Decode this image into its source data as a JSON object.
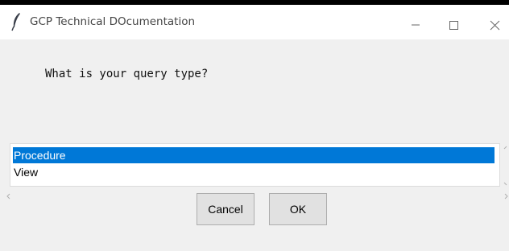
{
  "window": {
    "title": "GCP Technical DOcumentation",
    "controls": {
      "minimize_icon": "minimize-icon",
      "maximize_icon": "maximize-icon",
      "close_icon": "close-icon"
    }
  },
  "prompt": {
    "text": "What is your query type?"
  },
  "listbox": {
    "items": [
      {
        "label": "Procedure",
        "selected": true
      },
      {
        "label": "View",
        "selected": false
      }
    ]
  },
  "buttons": {
    "cancel_label": "Cancel",
    "ok_label": "OK"
  },
  "colors": {
    "selection": "#0078d7",
    "window_bg": "#f0f0f0",
    "titlebar_bg": "#ffffff"
  }
}
